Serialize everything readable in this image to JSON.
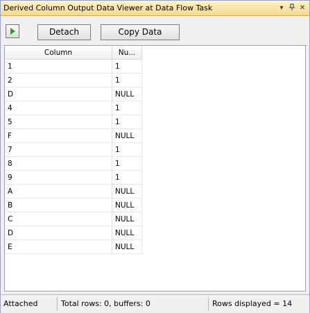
{
  "window": {
    "title": "Derived Column Output Data Viewer at Data Flow Task",
    "icons": [
      "dropdown-arrow-icon",
      "pin-icon",
      "close-icon"
    ]
  },
  "toolbar": {
    "play_icon": "play-icon",
    "detach_label": "Detach",
    "copy_label": "Copy Data"
  },
  "grid": {
    "columns": [
      "Column",
      "Nu..."
    ],
    "rows": [
      [
        "1",
        "1"
      ],
      [
        "2",
        "1"
      ],
      [
        "D",
        "NULL"
      ],
      [
        "4",
        "1"
      ],
      [
        "5",
        "1"
      ],
      [
        "F",
        "NULL"
      ],
      [
        "7",
        "1"
      ],
      [
        "8",
        "1"
      ],
      [
        "9",
        "1"
      ],
      [
        "A",
        "NULL"
      ],
      [
        "B",
        "NULL"
      ],
      [
        "C",
        "NULL"
      ],
      [
        "D",
        "NULL"
      ],
      [
        "E",
        "NULL"
      ]
    ]
  },
  "status": {
    "state": "Attached",
    "totals": "Total rows: 0, buffers: 0",
    "displayed": "Rows displayed = 14"
  }
}
